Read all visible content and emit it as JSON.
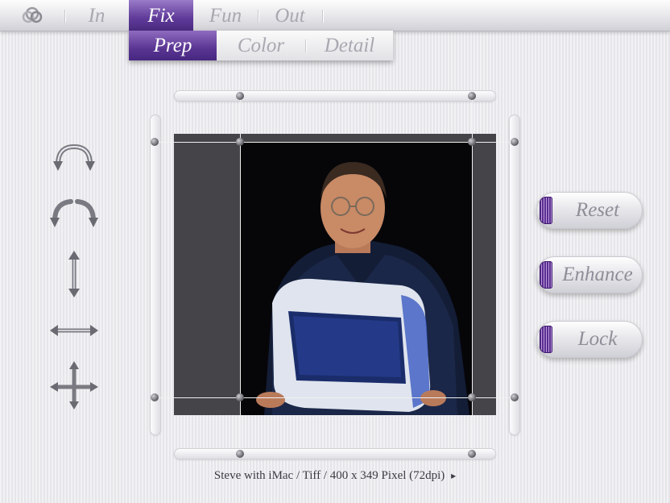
{
  "menu": {
    "tabs": [
      {
        "label": "In"
      },
      {
        "label": "Fix"
      },
      {
        "label": "Fun"
      },
      {
        "label": "Out"
      }
    ],
    "active": "Fix"
  },
  "submenu": {
    "tabs": [
      {
        "label": "Prep"
      },
      {
        "label": "Color"
      },
      {
        "label": "Detail"
      }
    ],
    "active": "Prep"
  },
  "tools": [
    {
      "icon": "rotate-180-icon"
    },
    {
      "icon": "rotate-left-right-icon"
    },
    {
      "icon": "flip-vertical-icon"
    },
    {
      "icon": "flip-horizontal-icon"
    },
    {
      "icon": "move-arrows-icon"
    }
  ],
  "actions": [
    {
      "label": "Reset"
    },
    {
      "label": "Enhance"
    },
    {
      "label": "Lock"
    }
  ],
  "image_info": {
    "caption": "Steve with iMac / Tiff / 400 x 349 Pixel (72dpi)",
    "arrow": "▸"
  },
  "colors": {
    "accent": "#5f3a98",
    "jewel": "#5b2d8e"
  }
}
